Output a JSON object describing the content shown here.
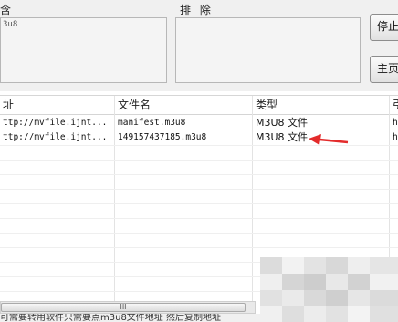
{
  "filters": {
    "include_label": "含",
    "include_value": "3u8",
    "exclude_label": "排 除",
    "exclude_value": ""
  },
  "buttons": {
    "stop_label": "停止",
    "home_label": "主页"
  },
  "table": {
    "columns": [
      "址",
      "文件名",
      "类型",
      "引"
    ],
    "rows": [
      {
        "address": "ttp://mvfile.ijnt...",
        "filename": "manifest.m3u8",
        "type": "M3U8 文件",
        "extra": "h"
      },
      {
        "address": "ttp://mvfile.ijnt...",
        "filename": "149157437185.m3u8",
        "type": "M3U8 文件",
        "extra": "h"
      }
    ]
  },
  "scrollbar": {
    "grip": "III"
  },
  "status": {
    "text": "可需要转用软件只需要点m3u8文件地址 然后复制地址"
  },
  "colors": {
    "arrow": "#e32b2b",
    "window_bg": "#f0f0f0"
  }
}
